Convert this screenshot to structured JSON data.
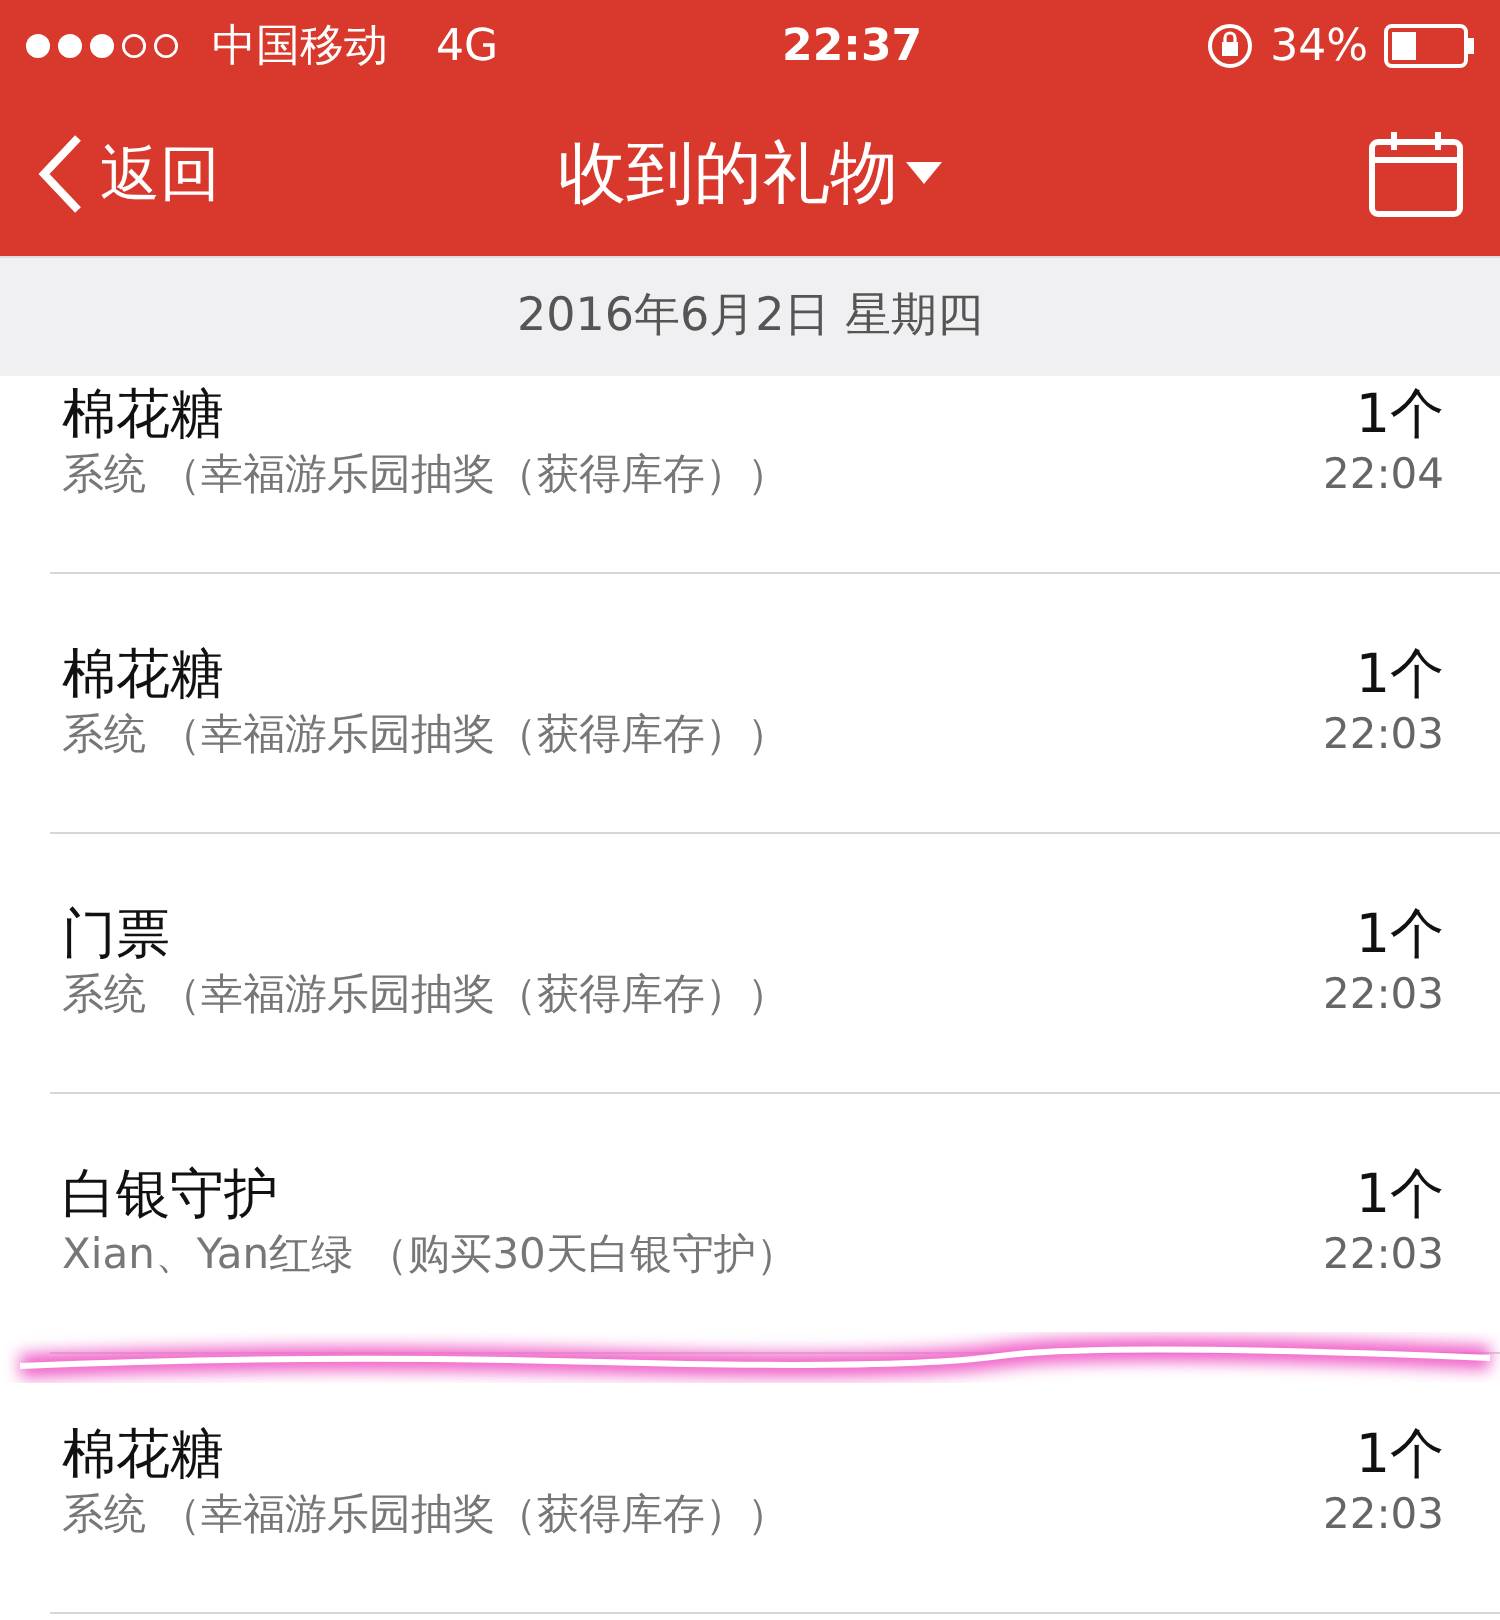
{
  "status_bar": {
    "carrier": "中国移动",
    "network": "4G",
    "time": "22:37",
    "battery": "34%"
  },
  "nav": {
    "back": "返回",
    "title": "收到的礼物"
  },
  "date_header": "2016年6月2日 星期四",
  "gifts": [
    {
      "name": "棉花糖",
      "source": "系统 （幸福游乐园抽奖（获得库存））",
      "count": "1个",
      "time": "22:04"
    },
    {
      "name": "棉花糖",
      "source": "系统 （幸福游乐园抽奖（获得库存））",
      "count": "1个",
      "time": "22:03"
    },
    {
      "name": "门票",
      "source": "系统 （幸福游乐园抽奖（获得库存））",
      "count": "1个",
      "time": "22:03"
    },
    {
      "name": "白银守护",
      "source": "Xian、Yan红绿 （购买30天白银守护）",
      "count": "1个",
      "time": "22:03"
    },
    {
      "name": "棉花糖",
      "source": "系统 （幸福游乐园抽奖（获得库存））",
      "count": "1个",
      "time": "22:03"
    }
  ]
}
